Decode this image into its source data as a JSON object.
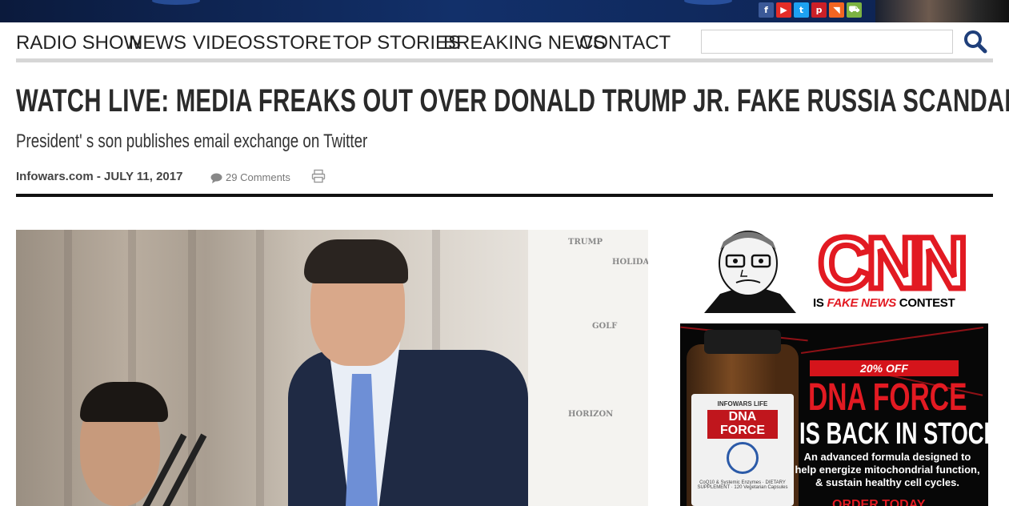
{
  "social": [
    {
      "icon": "facebook-icon",
      "glyph": "f",
      "color": "#3b5998"
    },
    {
      "icon": "youtube-icon",
      "glyph": "▶",
      "color": "#e52d27"
    },
    {
      "icon": "twitter-icon",
      "glyph": "t",
      "color": "#1da1f2"
    },
    {
      "icon": "pinterest-icon",
      "glyph": "p",
      "color": "#cb2027"
    },
    {
      "icon": "rss-icon",
      "glyph": "◥",
      "color": "#f26522"
    },
    {
      "icon": "cart-icon",
      "glyph": "⛟",
      "color": "#7cb342"
    }
  ],
  "nav": {
    "items": [
      "RADIO SHOW",
      "NEWS",
      "VIDEOS",
      "STORE",
      "TOP STORIES",
      "BREAKING NEWS",
      "CONTACT"
    ],
    "search_value": ""
  },
  "article": {
    "headline": "WATCH LIVE: MEDIA FREAKS OUT OVER DONALD TRUMP JR. FAKE RUSSIA SCANDAL",
    "subheadline": "President' s son publishes email exchange on Twitter",
    "byline": "Infowars.com - JULY 11, 2017",
    "comments": "29 Comments"
  },
  "ads": {
    "cnn": {
      "logo": "CNN",
      "tag_prefix": "IS ",
      "tag_highlight": "FAKE NEWS",
      "tag_suffix": " CONTEST"
    },
    "dna": {
      "bottle_brand": "INFOWARS LIFE",
      "bottle_name": "DNA FORCE",
      "bottle_fine": "CoQ10 & Systemic Enzymes · DIETARY SUPPLEMENT · 120 Vegetarian Capsules",
      "discount": "20% OFF",
      "title": "DNA FORCE",
      "subtitle": "IS BACK IN STOCK",
      "description": "An advanced formula designed to help energize mitochondrial function, & sustain healthy cell cycles.",
      "cta": "ORDER TODAY"
    }
  },
  "colors": {
    "accent_red": "#e21a22",
    "nav_text": "#222222",
    "search_icon": "#1f3f7a"
  }
}
